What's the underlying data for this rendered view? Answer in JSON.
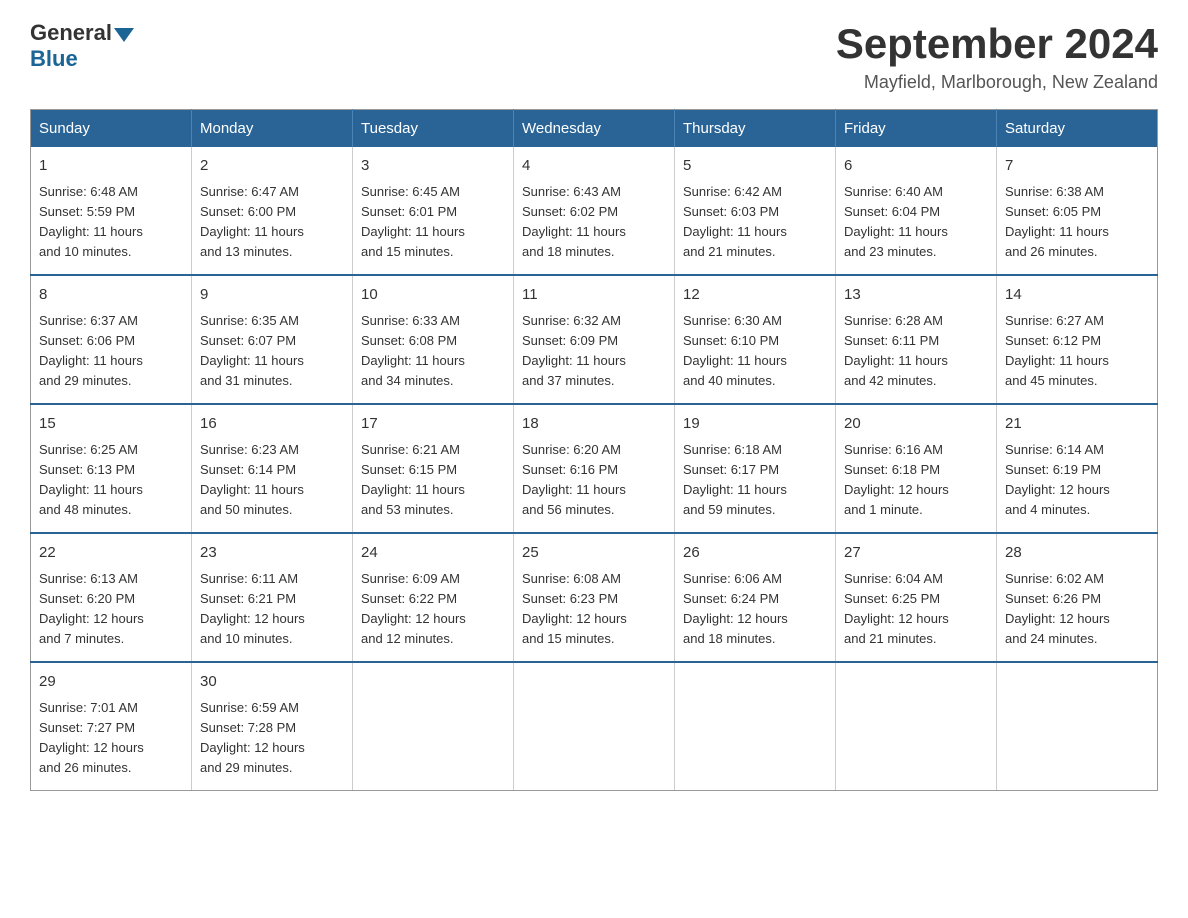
{
  "header": {
    "logo_general": "General",
    "logo_blue": "Blue",
    "month_title": "September 2024",
    "location": "Mayfield, Marlborough, New Zealand"
  },
  "weekdays": [
    "Sunday",
    "Monday",
    "Tuesday",
    "Wednesday",
    "Thursday",
    "Friday",
    "Saturday"
  ],
  "weeks": [
    [
      {
        "day": "1",
        "sunrise": "6:48 AM",
        "sunset": "5:59 PM",
        "daylight": "11 hours and 10 minutes."
      },
      {
        "day": "2",
        "sunrise": "6:47 AM",
        "sunset": "6:00 PM",
        "daylight": "11 hours and 13 minutes."
      },
      {
        "day": "3",
        "sunrise": "6:45 AM",
        "sunset": "6:01 PM",
        "daylight": "11 hours and 15 minutes."
      },
      {
        "day": "4",
        "sunrise": "6:43 AM",
        "sunset": "6:02 PM",
        "daylight": "11 hours and 18 minutes."
      },
      {
        "day": "5",
        "sunrise": "6:42 AM",
        "sunset": "6:03 PM",
        "daylight": "11 hours and 21 minutes."
      },
      {
        "day": "6",
        "sunrise": "6:40 AM",
        "sunset": "6:04 PM",
        "daylight": "11 hours and 23 minutes."
      },
      {
        "day": "7",
        "sunrise": "6:38 AM",
        "sunset": "6:05 PM",
        "daylight": "11 hours and 26 minutes."
      }
    ],
    [
      {
        "day": "8",
        "sunrise": "6:37 AM",
        "sunset": "6:06 PM",
        "daylight": "11 hours and 29 minutes."
      },
      {
        "day": "9",
        "sunrise": "6:35 AM",
        "sunset": "6:07 PM",
        "daylight": "11 hours and 31 minutes."
      },
      {
        "day": "10",
        "sunrise": "6:33 AM",
        "sunset": "6:08 PM",
        "daylight": "11 hours and 34 minutes."
      },
      {
        "day": "11",
        "sunrise": "6:32 AM",
        "sunset": "6:09 PM",
        "daylight": "11 hours and 37 minutes."
      },
      {
        "day": "12",
        "sunrise": "6:30 AM",
        "sunset": "6:10 PM",
        "daylight": "11 hours and 40 minutes."
      },
      {
        "day": "13",
        "sunrise": "6:28 AM",
        "sunset": "6:11 PM",
        "daylight": "11 hours and 42 minutes."
      },
      {
        "day": "14",
        "sunrise": "6:27 AM",
        "sunset": "6:12 PM",
        "daylight": "11 hours and 45 minutes."
      }
    ],
    [
      {
        "day": "15",
        "sunrise": "6:25 AM",
        "sunset": "6:13 PM",
        "daylight": "11 hours and 48 minutes."
      },
      {
        "day": "16",
        "sunrise": "6:23 AM",
        "sunset": "6:14 PM",
        "daylight": "11 hours and 50 minutes."
      },
      {
        "day": "17",
        "sunrise": "6:21 AM",
        "sunset": "6:15 PM",
        "daylight": "11 hours and 53 minutes."
      },
      {
        "day": "18",
        "sunrise": "6:20 AM",
        "sunset": "6:16 PM",
        "daylight": "11 hours and 56 minutes."
      },
      {
        "day": "19",
        "sunrise": "6:18 AM",
        "sunset": "6:17 PM",
        "daylight": "11 hours and 59 minutes."
      },
      {
        "day": "20",
        "sunrise": "6:16 AM",
        "sunset": "6:18 PM",
        "daylight": "12 hours and 1 minute."
      },
      {
        "day": "21",
        "sunrise": "6:14 AM",
        "sunset": "6:19 PM",
        "daylight": "12 hours and 4 minutes."
      }
    ],
    [
      {
        "day": "22",
        "sunrise": "6:13 AM",
        "sunset": "6:20 PM",
        "daylight": "12 hours and 7 minutes."
      },
      {
        "day": "23",
        "sunrise": "6:11 AM",
        "sunset": "6:21 PM",
        "daylight": "12 hours and 10 minutes."
      },
      {
        "day": "24",
        "sunrise": "6:09 AM",
        "sunset": "6:22 PM",
        "daylight": "12 hours and 12 minutes."
      },
      {
        "day": "25",
        "sunrise": "6:08 AM",
        "sunset": "6:23 PM",
        "daylight": "12 hours and 15 minutes."
      },
      {
        "day": "26",
        "sunrise": "6:06 AM",
        "sunset": "6:24 PM",
        "daylight": "12 hours and 18 minutes."
      },
      {
        "day": "27",
        "sunrise": "6:04 AM",
        "sunset": "6:25 PM",
        "daylight": "12 hours and 21 minutes."
      },
      {
        "day": "28",
        "sunrise": "6:02 AM",
        "sunset": "6:26 PM",
        "daylight": "12 hours and 24 minutes."
      }
    ],
    [
      {
        "day": "29",
        "sunrise": "7:01 AM",
        "sunset": "7:27 PM",
        "daylight": "12 hours and 26 minutes."
      },
      {
        "day": "30",
        "sunrise": "6:59 AM",
        "sunset": "7:28 PM",
        "daylight": "12 hours and 29 minutes."
      },
      null,
      null,
      null,
      null,
      null
    ]
  ],
  "labels": {
    "sunrise": "Sunrise:",
    "sunset": "Sunset:",
    "daylight": "Daylight:"
  }
}
